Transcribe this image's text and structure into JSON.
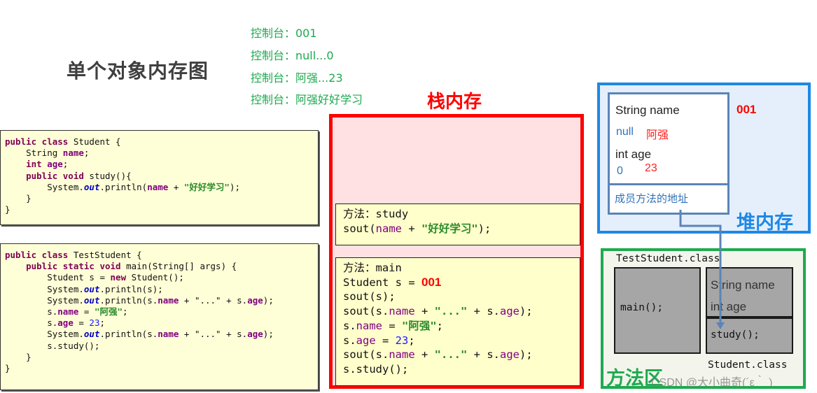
{
  "title": "单个对象内存图",
  "console": {
    "lines": [
      "控制台：001",
      "控制台：null...0",
      "控制台：阿强...23",
      "控制台：阿强好好学习"
    ]
  },
  "code_student": {
    "l1_kw": "public class",
    "l1_rest": " Student {",
    "l2_a": "    String ",
    "l2_f": "name",
    "l2_b": ";",
    "l3_kw": "    int ",
    "l3_f": "age",
    "l3_b": ";",
    "l4_kw": "    public void",
    "l4_rest": " study(){",
    "l5_a": "        System.",
    "l5_it": "out",
    "l5_b": ".println(",
    "l5_f": "name",
    "l5_c": " + ",
    "l5_s": "\"好好学习\"",
    "l5_d": ");",
    "l6": "    }",
    "l7": "}"
  },
  "code_test": {
    "l1_kw": "public class",
    "l1_rest": " TestStudent {",
    "l2_kw": "    public static void",
    "l2_rest": " main(String[] args) {",
    "l3_a": "        Student s = ",
    "l3_kw": "new",
    "l3_b": " Student();",
    "l4_a": "        System.",
    "l4_it": "out",
    "l4_b": ".println(s);",
    "l5_a": "        System.",
    "l5_it": "out",
    "l5_b": ".println(s.",
    "l5_f1": "name",
    "l5_c": " + \"...\" + s.",
    "l5_f2": "age",
    "l5_d": ");",
    "l6_a": "        s.",
    "l6_f": "name",
    "l6_b": " = ",
    "l6_s": "\"阿强\"",
    "l6_c": ";",
    "l7_a": "        s.",
    "l7_f": "age",
    "l7_b": " = ",
    "l7_n": "23",
    "l7_c": ";",
    "l8_a": "        System.",
    "l8_it": "out",
    "l8_b": ".println(s.",
    "l8_f1": "name",
    "l8_c": " + \"...\" + s.",
    "l8_f2": "age",
    "l8_d": ");",
    "l9": "        s.study();",
    "l10": "    }",
    "l11": "}"
  },
  "stack": {
    "label": "栈内存",
    "study_frame": {
      "method_prefix": "方法：",
      "method_name": "study",
      "line2_a": "sout(",
      "line2_f": "name",
      "line2_b": " + ",
      "line2_s": "\"好好学习\"",
      "line2_c": ");"
    },
    "main_frame": {
      "method_prefix": "方法：",
      "method_name": "main",
      "l2_a": "Student s = ",
      "l2_addr": "001",
      "l3": "sout(s);",
      "l4_a": "sout(s.",
      "l4_f1": "name",
      "l4_b": " + ",
      "l4_s": "\"...\"",
      "l4_c": " + s.",
      "l4_f2": "age",
      "l4_d": ");",
      "l5_a": "s.",
      "l5_f": "name",
      "l5_b": " = ",
      "l5_s": "\"阿强\"",
      "l5_c": ";",
      "l6_a": "s.",
      "l6_f": "age",
      "l6_b": " = ",
      "l6_n": "23",
      "l6_c": ";",
      "l7_a": "sout(s.",
      "l7_f1": "name",
      "l7_b": " + ",
      "l7_s": "\"...\"",
      "l7_c": " + s.",
      "l7_f2": "age",
      "l7_d": ");",
      "l8": "s.study();"
    }
  },
  "heap": {
    "label": "堆内存",
    "address": "001",
    "field_name_label": "String name",
    "name_default": "null",
    "name_value": "阿强",
    "field_age_label": "int age",
    "age_default": "0",
    "age_value": "23",
    "method_address_label": "成员方法的地址"
  },
  "method_area": {
    "label": "方法区",
    "test_class_label": "TestStudent.class",
    "main_method": "main();",
    "student_fields": [
      "String name",
      "int age"
    ],
    "study_method": "study();",
    "student_class_label": "Student.class"
  },
  "colors": {
    "stack_border": "#ff0000",
    "heap_border": "#1e88e5",
    "method_area_border": "#1faa50",
    "console_text": "#1faa50",
    "address_red": "#ff0000"
  },
  "watermark": "CSDN @大小曲奇(´ε｀ )"
}
